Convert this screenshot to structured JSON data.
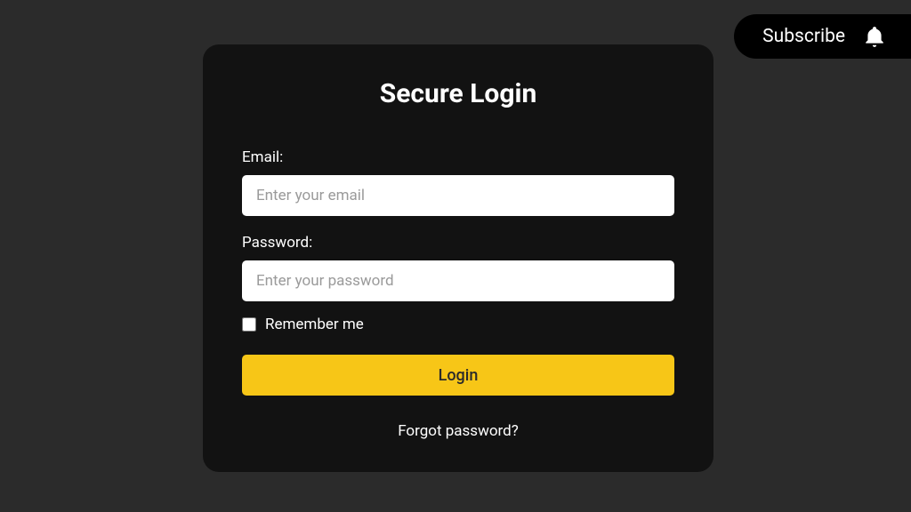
{
  "subscribe": {
    "label": "Subscribe"
  },
  "login": {
    "title": "Secure Login",
    "email_label": "Email:",
    "email_placeholder": "Enter your email",
    "password_label": "Password:",
    "password_placeholder": "Enter your password",
    "remember_label": "Remember me",
    "button_label": "Login",
    "forgot_label": "Forgot password?"
  },
  "colors": {
    "background": "#2b2b2b",
    "card": "#121212",
    "accent": "#f7c617"
  }
}
